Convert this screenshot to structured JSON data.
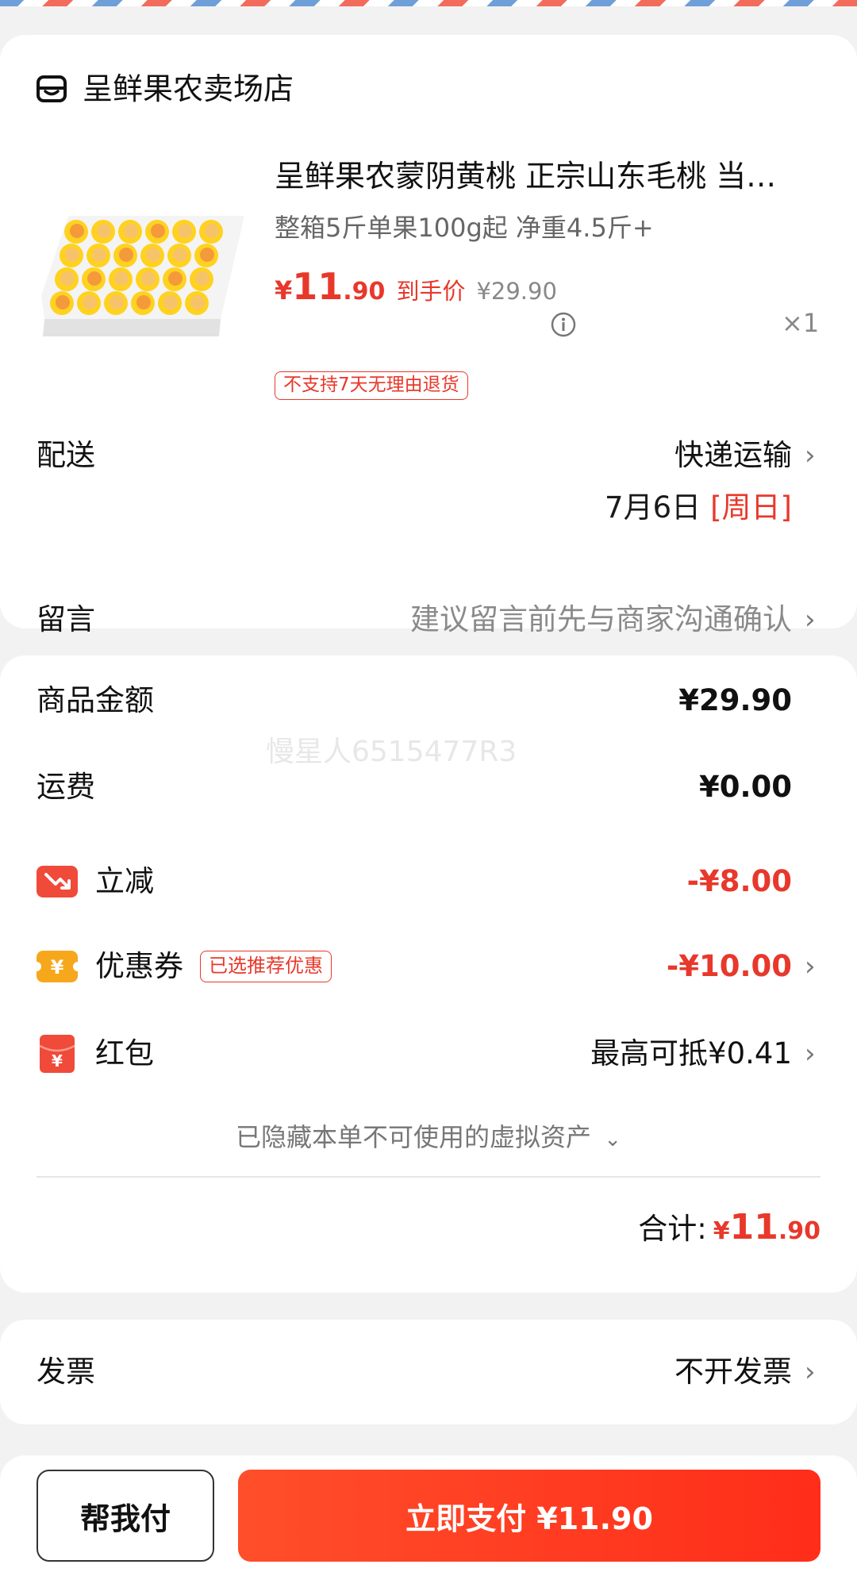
{
  "order": {
    "shop_name": "呈鲜果农卖场店",
    "product": {
      "title": "呈鲜果农蒙阴黄桃 正宗山东毛桃 当季新鲜水果",
      "spec": "整箱5斤单果100g起 净重4.5斤+",
      "price_yen": "¥",
      "price_int": "11",
      "price_dec": ".90",
      "price_tag": "到手价",
      "original_price": "¥29.90",
      "quantity": "×1",
      "return_policy": "不支持7天无理由退货"
    },
    "delivery": {
      "label": "配送",
      "method": "快递运输",
      "date": "7月6日",
      "weekday": "[周日]"
    },
    "message": {
      "label": "留言",
      "placeholder": "建议留言前先与商家沟通确认"
    }
  },
  "summary": {
    "watermark": "慢星人6515477R3",
    "goods_amount": {
      "label": "商品金额",
      "value": "¥29.90"
    },
    "shipping": {
      "label": "运费",
      "value": "¥0.00"
    },
    "instant_discount": {
      "label": "立减",
      "value": "-¥8.00"
    },
    "coupon": {
      "label": "优惠券",
      "badge": "已选推荐优惠",
      "value": "-¥10.00"
    },
    "red_packet": {
      "label": "红包",
      "value": "最高可抵¥0.41"
    },
    "hidden_assets": "已隐藏本单不可使用的虚拟资产",
    "total": {
      "label": "合计:",
      "yen": "¥",
      "int": "11",
      "dec": ".90"
    }
  },
  "invoice": {
    "label": "发票",
    "value": "不开发票"
  },
  "bottom_bar": {
    "friend_pay_label": "帮我付",
    "pay_label": "立即支付 ¥11.90"
  },
  "icons": {
    "shop": "shop-icon",
    "info": "info-icon",
    "chevron": "chevron-right-icon",
    "discount": "discount-arrow-icon",
    "coupon": "coupon-yen-icon",
    "red_packet": "red-packet-icon"
  },
  "colors": {
    "accent_red": "#e8382b",
    "pay_button": "#ff3a1f",
    "coupon_orange": "#f5a623"
  }
}
